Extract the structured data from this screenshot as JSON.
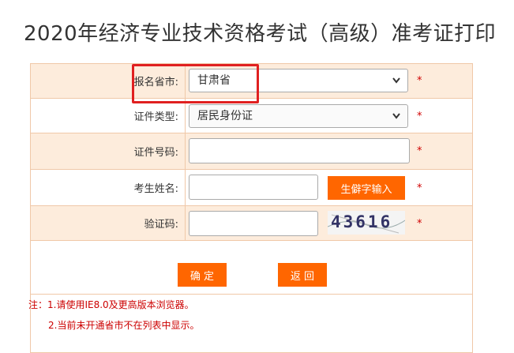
{
  "page": {
    "title": "2020年经济专业技术资格考试（高级）准考证打印"
  },
  "form": {
    "province": {
      "label": "报名省市:",
      "value": "甘肃省"
    },
    "id_type": {
      "label": "证件类型:",
      "value": "居民身份证"
    },
    "id_number": {
      "label": "证件号码:"
    },
    "name": {
      "label": "考生姓名:",
      "rare_char_button": "生僻字输入"
    },
    "captcha": {
      "label": "验证码:",
      "image_text": "43616"
    },
    "required_mark": "*"
  },
  "actions": {
    "confirm": "确 定",
    "back": "返 回"
  },
  "notes": {
    "line1": "注：1.请使用IE8.0及更高版本浏览器。",
    "line2": "2.当前未开通省市不在列表中显示。"
  },
  "colors": {
    "accent": "#ff6600",
    "highlight_box": "#e02020",
    "row_shade": "#fdecdc",
    "border": "#f0c8a8"
  }
}
